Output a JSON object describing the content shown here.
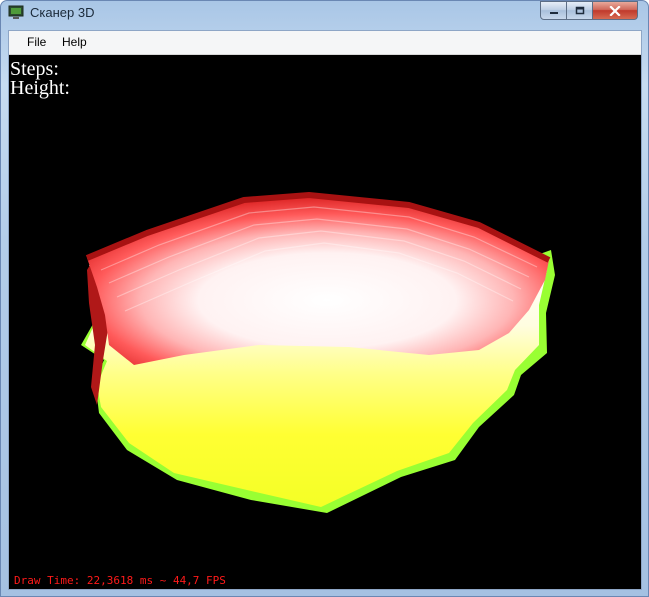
{
  "window": {
    "title": "Сканер 3D",
    "icon": "app-monitor-icon",
    "controls": {
      "minimize": "minimize-icon",
      "maximize": "maximize-icon",
      "close": "close-icon"
    }
  },
  "menu": {
    "file": "File",
    "help": "Help"
  },
  "viewport": {
    "steps_label": "Steps:",
    "height_label": "Height:",
    "fps_text": "Draw Time: 22,3618 ms ~ 44,7 FPS",
    "background": "#000000",
    "colors": {
      "top": "#d62020",
      "top_inner": "#ffffff",
      "middle": "#ffff33",
      "side": "#99ff33",
      "fps_text": "#ff1a1a"
    }
  }
}
